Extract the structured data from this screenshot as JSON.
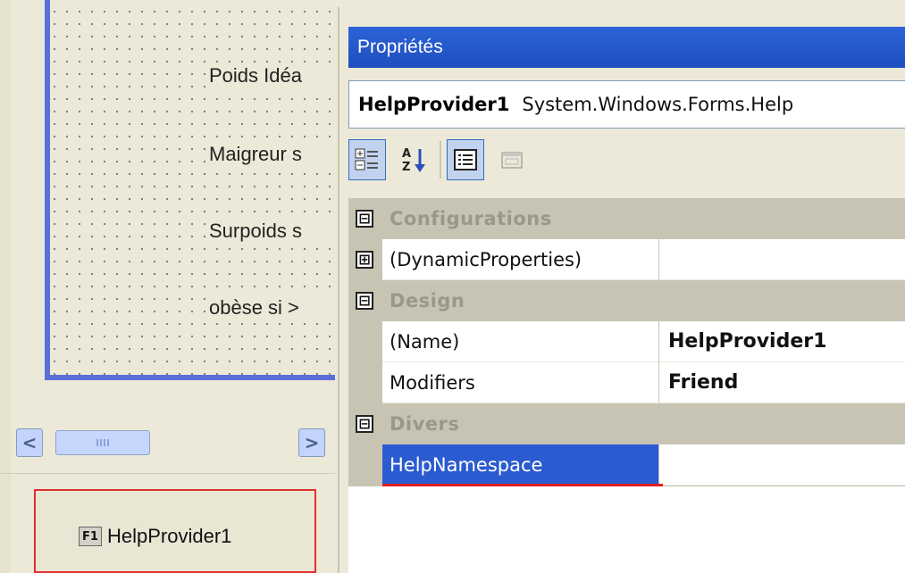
{
  "designer": {
    "labels": [
      "Poids Idéa",
      "Maigreur s",
      "Surpoids s",
      "obèse si >"
    ],
    "scrollbar": {
      "left_arrow": "<",
      "right_arrow": ">"
    },
    "tray_component": {
      "icon_text": "F1",
      "label": "HelpProvider1"
    }
  },
  "properties": {
    "title": "Propriétés",
    "object_name": "HelpProvider1",
    "object_type": "System.Windows.Forms.Help",
    "toolbar": [
      "categorized-icon",
      "alphabetical-icon",
      "properties-icon",
      "events-icon"
    ],
    "categories": [
      {
        "label": "Configurations",
        "expander": "⊟",
        "items": [
          {
            "name": "(DynamicProperties)",
            "value": "",
            "expander": "⊞"
          }
        ]
      },
      {
        "label": "Design",
        "expander": "⊟",
        "items": [
          {
            "name": "(Name)",
            "value": "HelpProvider1"
          },
          {
            "name": "Modifiers",
            "value": "Friend"
          }
        ]
      },
      {
        "label": "Divers",
        "expander": "⊟",
        "items": [
          {
            "name": "HelpNamespace",
            "value": ""
          }
        ]
      }
    ]
  },
  "colors": {
    "title_bar": "#2c63d6",
    "selection": "#2b5bd0",
    "highlight_border": "#e03030",
    "form_border": "#5b6fd6"
  }
}
